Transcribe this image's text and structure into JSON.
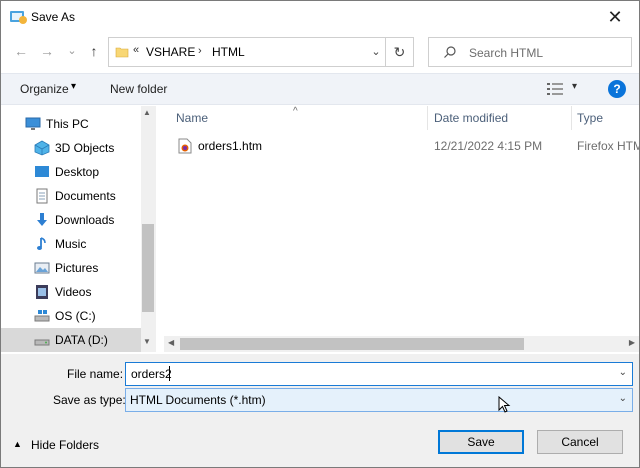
{
  "window": {
    "title": "Save As",
    "close_glyph": "✕"
  },
  "nav": {
    "back_glyph": "←",
    "forward_glyph": "→",
    "recent_glyph": "⌄",
    "up_glyph": "↑",
    "overflow": "«",
    "path": [
      "VSHARE",
      "HTML"
    ],
    "separator": "›",
    "dropdown_glyph": "⌄",
    "refresh_glyph": "↻"
  },
  "search": {
    "placeholder": "Search HTML"
  },
  "toolbar": {
    "organize_label": "Organize",
    "organize_caret": "▾",
    "new_folder_label": "New folder",
    "view_caret": "▾",
    "help_label": "?"
  },
  "sidebar": {
    "items": [
      {
        "label": "This PC",
        "icon": "monitor-icon"
      },
      {
        "label": "3D Objects",
        "icon": "cube-icon"
      },
      {
        "label": "Desktop",
        "icon": "desktop-icon"
      },
      {
        "label": "Documents",
        "icon": "documents-icon"
      },
      {
        "label": "Downloads",
        "icon": "download-icon"
      },
      {
        "label": "Music",
        "icon": "music-icon"
      },
      {
        "label": "Pictures",
        "icon": "pictures-icon"
      },
      {
        "label": "Videos",
        "icon": "videos-icon"
      },
      {
        "label": "OS (C:)",
        "icon": "drive-icon"
      },
      {
        "label": "DATA (D:)",
        "icon": "drive-icon"
      }
    ],
    "selected": "DATA (D:)"
  },
  "file_list": {
    "columns": [
      "Name",
      "Date modified",
      "Type"
    ],
    "sort_glyph": "^",
    "rows": [
      {
        "name": "orders1.htm",
        "date": "12/21/2022 4:15 PM",
        "type": "Firefox HTM"
      }
    ]
  },
  "form": {
    "file_name_label": "File name:",
    "file_name_value": "orders2",
    "save_type_label": "Save as type:",
    "save_type_value": "HTML Documents (*.htm)",
    "dropdown_glyph": "⌄"
  },
  "footer": {
    "hide_folders_label": "Hide Folders",
    "hide_caret": "▲",
    "save_label": "Save",
    "cancel_label": "Cancel"
  },
  "colors": {
    "accent": "#0078d7",
    "toolbar_bg": "#f0f3f8",
    "selected_bg": "#d9d9d9",
    "help_blue": "#0a74da"
  }
}
